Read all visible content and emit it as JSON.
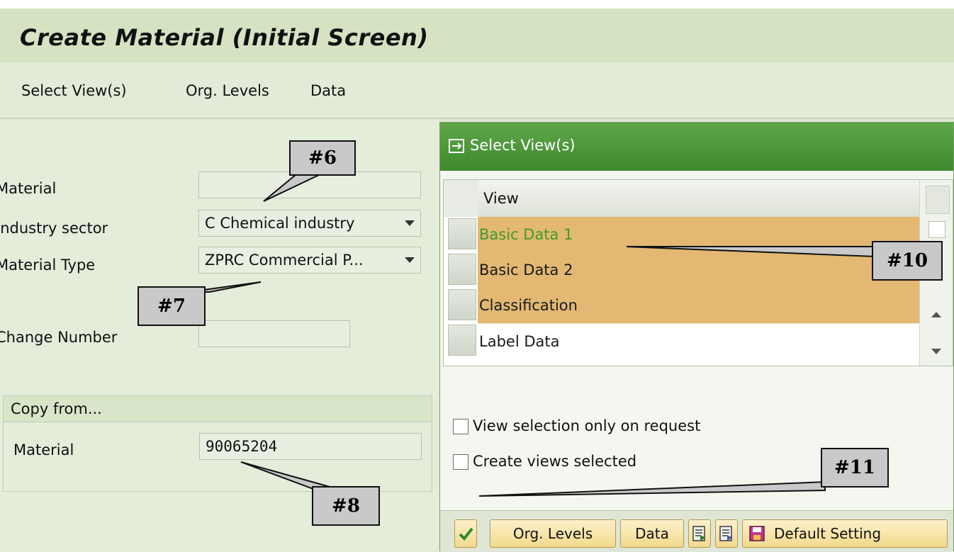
{
  "window": {
    "title": "Create Material (Initial Screen)"
  },
  "menu": {
    "items": [
      "Select View(s)",
      "Org. Levels",
      "Data"
    ]
  },
  "form": {
    "material_label": "Material",
    "industry_label": "Industry sector",
    "industry_value": "C Chemical industry",
    "type_label": "Material Type",
    "type_value": "ZPRC Commercial P...",
    "change_label": "Change Number",
    "copy_from": {
      "header": "Copy from...",
      "material_label": "Material",
      "material_value": "90065204"
    }
  },
  "callouts": {
    "c6": "#6",
    "c7": "#7",
    "c8": "#8",
    "c10": "#10",
    "c11": "#11"
  },
  "dialog": {
    "title": "Select View(s)",
    "column_header": "View",
    "rows": [
      {
        "label": "Basic Data 1",
        "selected": true,
        "color": "#3f9a2a"
      },
      {
        "label": "Basic Data 2",
        "selected": true
      },
      {
        "label": "Classification",
        "selected": true
      },
      {
        "label": "Label Data",
        "selected": false
      }
    ],
    "checkboxes": [
      {
        "label": "View selection only on request",
        "checked": false
      },
      {
        "label": "Create views selected",
        "checked": false
      }
    ],
    "toolbar": {
      "org_levels": "Org. Levels",
      "data": "Data",
      "default_setting": "Default Setting",
      "icons": [
        "continue-check-icon",
        "select-all-icon",
        "deselect-all-icon",
        "save-icon"
      ]
    }
  },
  "colors": {
    "selected_row": "#e2b872",
    "dialog_header": "#4f9a3c",
    "title_bar": "#d6e3c3"
  }
}
